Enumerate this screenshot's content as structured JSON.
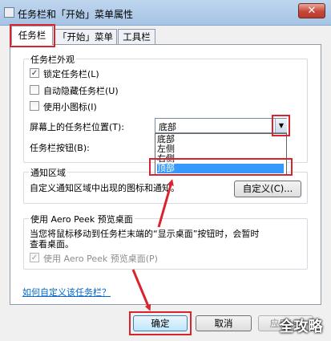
{
  "window": {
    "title": "任务栏和「开始」菜单属性",
    "close_glyph": "✕"
  },
  "tabs": [
    {
      "label": "任务栏"
    },
    {
      "label": "「开始」菜单"
    },
    {
      "label": "工具栏"
    }
  ],
  "appearance": {
    "title": "任务栏外观",
    "options": [
      {
        "label": "锁定任务栏(L)",
        "checked": true
      },
      {
        "label": "自动隐藏任务栏(U)",
        "checked": false
      },
      {
        "label": "使用小图标(I)",
        "checked": false
      }
    ],
    "position_label": "屏幕上的任务栏位置(T):",
    "position_value": "底部",
    "buttons_label": "任务栏按钮(B):",
    "dropdown_items": [
      "底部",
      "左侧",
      "右侧",
      "顶部"
    ],
    "selected_index": 3
  },
  "notification": {
    "title": "通知区域",
    "text": "自定义通知区域中出现的图标和通知。",
    "customize_label": "自定义(C)..."
  },
  "peek": {
    "title": "使用 Aero Peek 预览桌面",
    "text_line1": "当您将鼠标移动到任务栏末端的“显示桌面”按钮时，会暂时",
    "text_line2": "查看桌面。",
    "checkbox_label": "使用 Aero Peek 预览桌面(P)",
    "checked": true
  },
  "help_link": "如何自定义该任务栏？",
  "buttons": {
    "ok": "确定",
    "cancel": "取消",
    "apply": "应用(A)"
  },
  "watermark": "全攻略",
  "colors": {
    "highlight": "#d9232e",
    "selection": "#3399ff",
    "link": "#0066cc"
  },
  "check_glyph": "✓"
}
